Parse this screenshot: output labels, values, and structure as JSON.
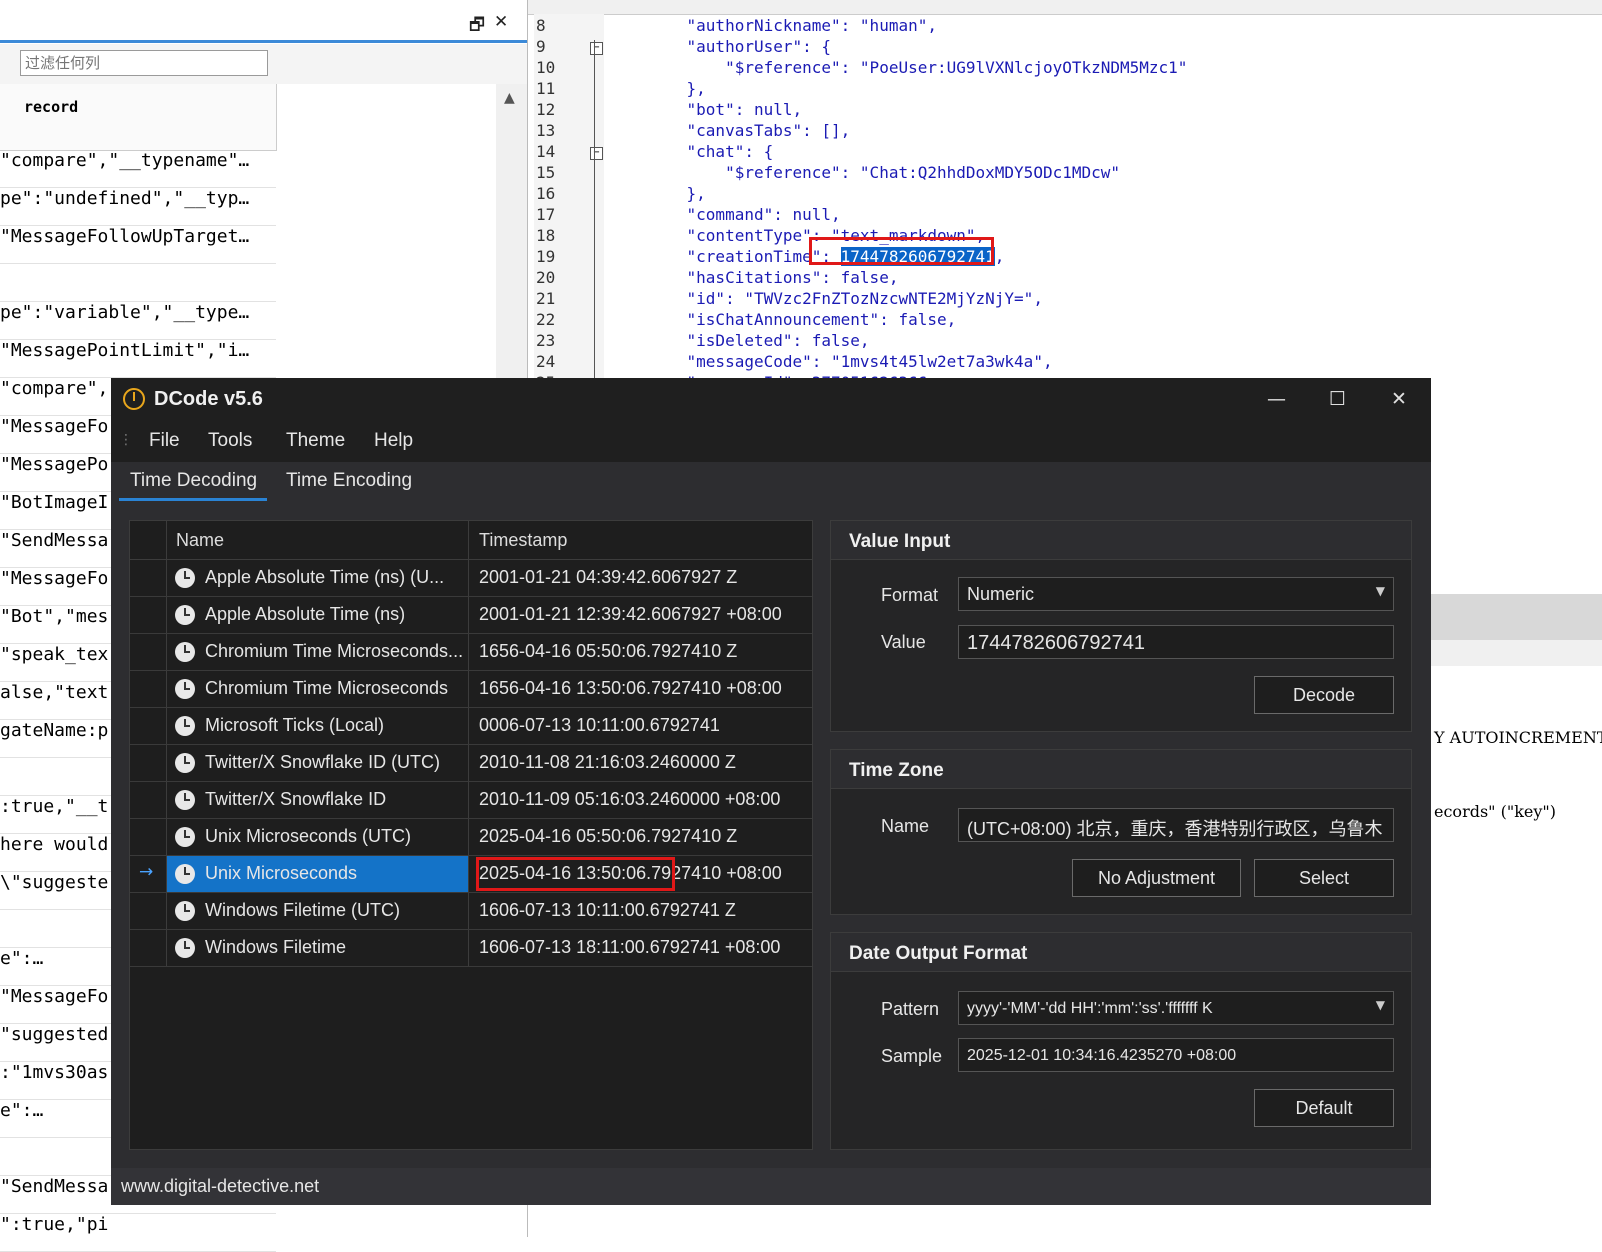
{
  "left_panel": {
    "filter_placeholder": "过滤任何列",
    "column_header": "record",
    "icon_restore": "restore-icon",
    "icon_close": "close-icon",
    "rows": [
      "\"compare\",\"__typename\"…",
      "pe\":\"undefined\",\"__typ…",
      "\"MessageFollowUpTarget…",
      "",
      "pe\":\"variable\",\"__type…",
      "\"MessagePointLimit\",\"i…",
      "\"compare\",",
      "\"MessageFo",
      "\"MessagePo",
      "\"BotImageI",
      "\"SendMessa",
      "\"MessageFo",
      "\"Bot\",\"mes",
      "\"speak_tex",
      "alse,\"text",
      "gateName:p",
      "",
      ":true,\"__t",
      "here would",
      "\\\"suggeste",
      "",
      "e\":…",
      "\"MessageFo",
      "\"suggested",
      ":\"1mvs30as",
      "e\":…",
      "",
      "\"SendMessa",
      "\":true,\"pi"
    ]
  },
  "code_editor": {
    "lines": [
      {
        "num": "8",
        "code": "    \"authorNickname\": \"human\","
      },
      {
        "num": "9",
        "code": "    \"authorUser\": {"
      },
      {
        "num": "10",
        "code": "        \"$reference\": \"PoeUser:UG9lVXNlcjoyOTkzNDM5Mzc1\""
      },
      {
        "num": "11",
        "code": "    },"
      },
      {
        "num": "12",
        "code": "    \"bot\": null,"
      },
      {
        "num": "13",
        "code": "    \"canvasTabs\": [],"
      },
      {
        "num": "14",
        "code": "    \"chat\": {"
      },
      {
        "num": "15",
        "code": "        \"$reference\": \"Chat:Q2hhdDoxMDY5ODc1MDcw\""
      },
      {
        "num": "16",
        "code": "    },"
      },
      {
        "num": "17",
        "code": "    \"command\": null,"
      },
      {
        "num": "18",
        "code": "    \"contentType\": \"text_markdown\","
      },
      {
        "num": "19",
        "code_key": "    \"creationTime\": ",
        "code_value": "1744782606792741",
        "code_tail": ","
      },
      {
        "num": "20",
        "code": "    \"hasCitations\": false,"
      },
      {
        "num": "21",
        "code": "    \"id\": \"TWVzc2FnZTozNzcwNTE2MjYzNjY=\","
      },
      {
        "num": "22",
        "code": "    \"isChatAnnouncement\": false,"
      },
      {
        "num": "23",
        "code": "    \"isDeleted\": false,"
      },
      {
        "num": "24",
        "code": "    \"messageCode\": \"1mvs4t45lw2et7a3wk4a\","
      },
      {
        "num": "25",
        "code": "    \"messageId\": 377051626366,"
      }
    ],
    "fragment_1": "Y AUTOINCREMENT",
    "fragment_2": "ecords\" (\"key\")"
  },
  "dcode": {
    "title": "DCode v5.6",
    "logo_icon": "dcode-logo-icon",
    "window_buttons": {
      "minimize": "—",
      "maximize": "☐",
      "close": "✕"
    },
    "menu": [
      "File",
      "Tools",
      "Theme",
      "Help"
    ],
    "tabs": [
      "Time Decoding",
      "Time Encoding"
    ],
    "active_tab": "Time Decoding",
    "grid": {
      "headers": [
        "Name",
        "Timestamp"
      ],
      "rows": [
        {
          "name": "Apple Absolute Time (ns) (U...",
          "timestamp": "2001-01-21 04:39:42.6067927 Z"
        },
        {
          "name": "Apple Absolute Time (ns)",
          "timestamp": "2001-01-21 12:39:42.6067927 +08:00"
        },
        {
          "name": "Chromium Time Microseconds...",
          "timestamp": "1656-04-16 05:50:06.7927410 Z"
        },
        {
          "name": "Chromium Time Microseconds",
          "timestamp": "1656-04-16 13:50:06.7927410 +08:00"
        },
        {
          "name": "Microsoft Ticks (Local)",
          "timestamp": "0006-07-13 10:11:00.6792741"
        },
        {
          "name": "Twitter/X Snowflake ID (UTC)",
          "timestamp": "2010-11-08 21:16:03.2460000 Z"
        },
        {
          "name": "Twitter/X Snowflake ID",
          "timestamp": "2010-11-09 05:16:03.2460000 +08:00"
        },
        {
          "name": "Unix Microseconds (UTC)",
          "timestamp": "2025-04-16 05:50:06.7927410 Z"
        },
        {
          "name": "Unix Microseconds",
          "timestamp": "2025-04-16 13:50:06.7927410 +08:00",
          "selected": true
        },
        {
          "name": "Windows Filetime (UTC)",
          "timestamp": "1606-07-13 10:11:00.6792741 Z"
        },
        {
          "name": "Windows Filetime",
          "timestamp": "1606-07-13 18:11:00.6792741 +08:00"
        }
      ]
    },
    "value_input": {
      "title": "Value Input",
      "format_label": "Format",
      "format_value": "Numeric",
      "value_label": "Value",
      "value": "1744782606792741",
      "decode_button": "Decode"
    },
    "time_zone": {
      "title": "Time Zone",
      "name_label": "Name",
      "name_value": "(UTC+08:00) 北京，重庆，香港特别行政区，乌鲁木",
      "no_adjustment_button": "No Adjustment",
      "select_button": "Select"
    },
    "date_output": {
      "title": "Date Output Format",
      "pattern_label": "Pattern",
      "pattern_value": "yyyy'-'MM'-'dd HH':'mm':'ss'.'fffffff K",
      "sample_label": "Sample",
      "sample_value": "2025-12-01 10:34:16.4235270 +08:00",
      "default_button": "Default"
    },
    "status": "www.digital-detective.net",
    "colors": {
      "accent": "#1473c8",
      "highlight_border": "#e01818",
      "background": "#1f1f1f"
    }
  }
}
